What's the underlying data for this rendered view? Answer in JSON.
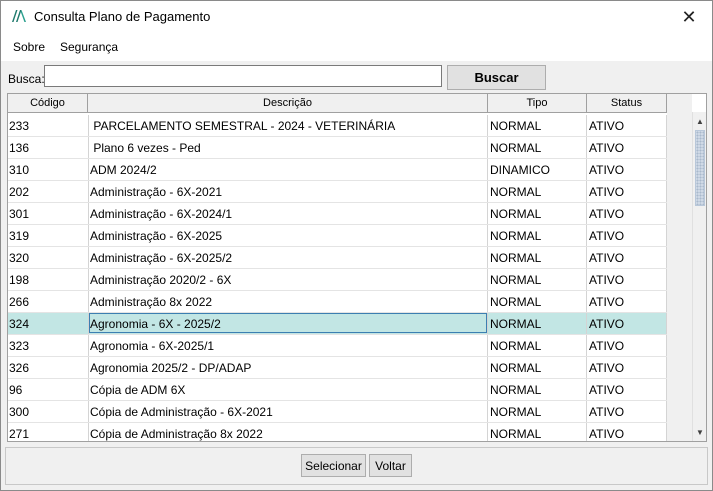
{
  "window": {
    "title": "Consulta Plano de Pagamento",
    "close_label": "✕",
    "icon": "app-logo-icon"
  },
  "menu": [
    {
      "label": "Sobre"
    },
    {
      "label": "Segurança"
    }
  ],
  "search": {
    "label": "Busca:",
    "value": "",
    "placeholder": "",
    "button_label": "Buscar"
  },
  "table": {
    "columns": [
      "Código",
      "Descrição",
      "Tipo",
      "Status"
    ],
    "selected_index": 9,
    "rows": [
      {
        "codigo": "233",
        "descricao": " PARCELAMENTO SEMESTRAL - 2024 - VETERINÁRIA",
        "tipo": "NORMAL",
        "status": "ATIVO"
      },
      {
        "codigo": "136",
        "descricao": " Plano 6 vezes - Ped",
        "tipo": "NORMAL",
        "status": "ATIVO"
      },
      {
        "codigo": "310",
        "descricao": "ADM 2024/2",
        "tipo": "DINAMICO",
        "status": "ATIVO"
      },
      {
        "codigo": "202",
        "descricao": "Administração - 6X-2021",
        "tipo": "NORMAL",
        "status": "ATIVO"
      },
      {
        "codigo": "301",
        "descricao": "Administração - 6X-2024/1",
        "tipo": "NORMAL",
        "status": "ATIVO"
      },
      {
        "codigo": "319",
        "descricao": "Administração - 6X-2025",
        "tipo": "NORMAL",
        "status": "ATIVO"
      },
      {
        "codigo": "320",
        "descricao": "Administração - 6X-2025/2",
        "tipo": "NORMAL",
        "status": "ATIVO"
      },
      {
        "codigo": "198",
        "descricao": "Administração 2020/2 - 6X",
        "tipo": "NORMAL",
        "status": "ATIVO"
      },
      {
        "codigo": "266",
        "descricao": "Administração 8x 2022",
        "tipo": "NORMAL",
        "status": "ATIVO"
      },
      {
        "codigo": "324",
        "descricao": "Agronomia - 6X - 2025/2",
        "tipo": "NORMAL",
        "status": "ATIVO"
      },
      {
        "codigo": "323",
        "descricao": "Agronomia - 6X-2025/1",
        "tipo": "NORMAL",
        "status": "ATIVO"
      },
      {
        "codigo": "326",
        "descricao": "Agronomia 2025/2 - DP/ADAP",
        "tipo": "NORMAL",
        "status": "ATIVO"
      },
      {
        "codigo": "96",
        "descricao": "Cópia de ADM 6X",
        "tipo": "NORMAL",
        "status": "ATIVO"
      },
      {
        "codigo": "300",
        "descricao": "Cópia de Administração - 6X-2021",
        "tipo": "NORMAL",
        "status": "ATIVO"
      },
      {
        "codigo": "271",
        "descricao": "Cópia de Administração 8x 2022",
        "tipo": "NORMAL",
        "status": "ATIVO"
      }
    ]
  },
  "buttons": {
    "select_label": "Selecionar",
    "back_label": "Voltar"
  },
  "colors": {
    "selected_row": "#c2e6e4",
    "logo": "#1f7a6d"
  }
}
